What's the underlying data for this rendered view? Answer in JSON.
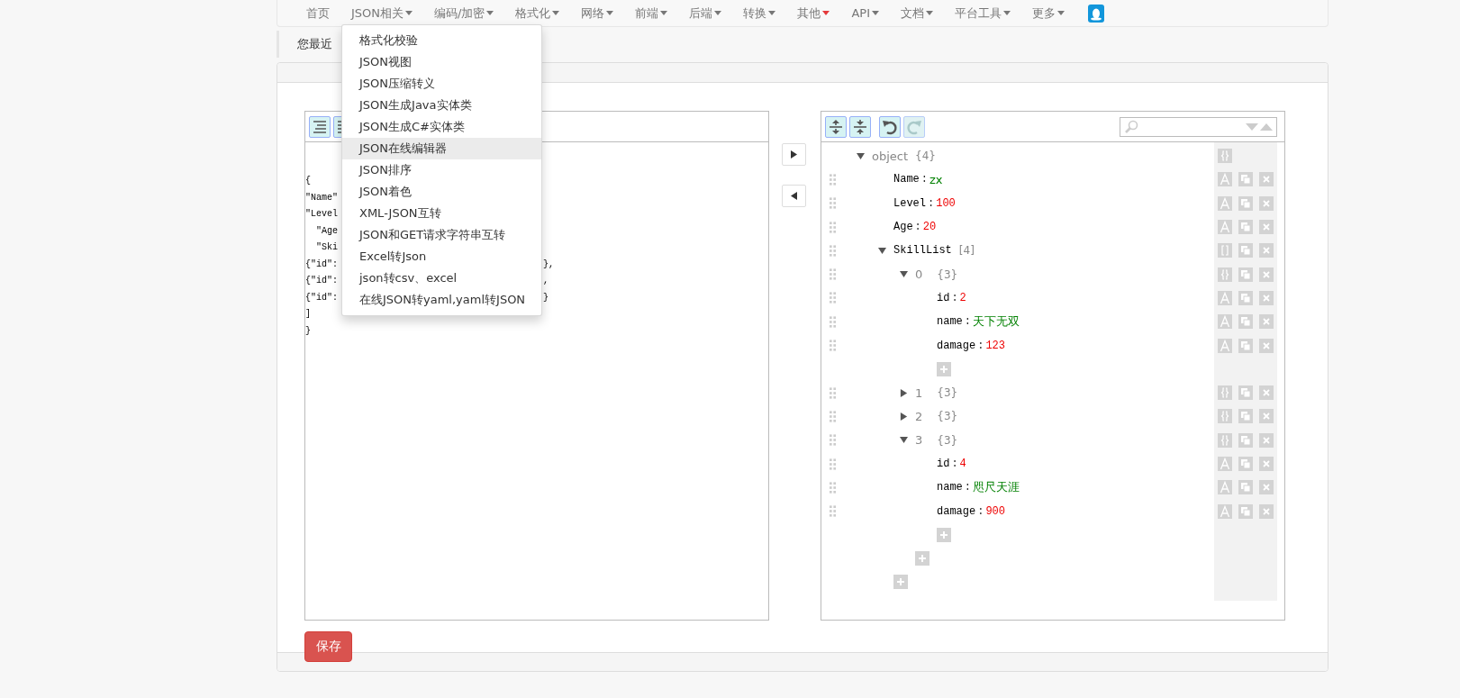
{
  "nav": {
    "items": [
      {
        "label": "首页",
        "dropdown": false
      },
      {
        "label": "JSON相关",
        "dropdown": true,
        "hot": false
      },
      {
        "label": "编码/加密",
        "dropdown": true,
        "hot": false
      },
      {
        "label": "格式化",
        "dropdown": true,
        "hot": false
      },
      {
        "label": "网络",
        "dropdown": true,
        "hot": false
      },
      {
        "label": "前端",
        "dropdown": true,
        "hot": false
      },
      {
        "label": "后端",
        "dropdown": true,
        "hot": false
      },
      {
        "label": "转换",
        "dropdown": true,
        "hot": false
      },
      {
        "label": "其他",
        "dropdown": true,
        "hot": true
      },
      {
        "label": "API",
        "dropdown": true,
        "hot": false
      },
      {
        "label": "文档",
        "dropdown": true,
        "hot": false
      },
      {
        "label": "平台工具",
        "dropdown": true,
        "hot": false
      },
      {
        "label": "更多",
        "dropdown": true,
        "hot": false
      }
    ]
  },
  "recent": {
    "text": "您最近"
  },
  "dropdown": {
    "items": [
      {
        "label": "格式化校验",
        "selected": false
      },
      {
        "label": "JSON视图",
        "selected": false
      },
      {
        "label": "JSON压缩转义",
        "selected": false
      },
      {
        "label": "JSON生成Java实体类",
        "selected": false
      },
      {
        "label": "JSON生成C#实体类",
        "selected": false
      },
      {
        "label": "JSON在线编辑器",
        "selected": true
      },
      {
        "label": "JSON排序",
        "selected": false
      },
      {
        "label": "JSON着色",
        "selected": false
      },
      {
        "label": "XML-JSON互转",
        "selected": false
      },
      {
        "label": "JSON和GET请求字符串互转",
        "selected": false
      },
      {
        "label": "Excel转Json",
        "selected": false
      },
      {
        "label": "json转csv、excel",
        "selected": false
      },
      {
        "label": "在线JSON转yaml,yaml转JSON",
        "selected": false
      }
    ]
  },
  "code_editor": {
    "toolbar": [
      {
        "kind": "format"
      },
      {
        "kind": "compact"
      }
    ],
    "lines": [
      {
        "left": "{"
      },
      {
        "left": "\"Name\""
      },
      {
        "left": "\"Level"
      },
      {
        "left": "  \"Age"
      },
      {
        "left": "  \"Ski"
      },
      {
        "left": "{\"id\":",
        "right": "},"
      },
      {
        "left": "{\"id\":",
        "right": ","
      },
      {
        "left": "{\"id\":",
        "right": "}"
      },
      {
        "left": "]"
      },
      {
        "left": "}"
      }
    ]
  },
  "tree_editor": {
    "toolbar": [
      {
        "kind": "expand-all",
        "disabled": false
      },
      {
        "kind": "collapse-all",
        "disabled": false
      },
      {
        "kind": "undo",
        "disabled": false
      },
      {
        "kind": "redo",
        "disabled": true
      }
    ],
    "tree": {
      "key": "object",
      "count": "{4}",
      "kind": "object",
      "expanded": true,
      "children": [
        {
          "key": "Name",
          "sep": ":",
          "value": "zx",
          "kind": "string"
        },
        {
          "key": "Level",
          "sep": ":",
          "value": "100",
          "kind": "number"
        },
        {
          "key": "Age",
          "sep": ":",
          "value": "20",
          "kind": "number"
        },
        {
          "key": "SkillList",
          "count": "[4]",
          "kind": "array",
          "expanded": true,
          "children": [
            {
              "key": "0",
              "count": "{3}",
              "kind": "object",
              "expanded": true,
              "children": [
                {
                  "key": "id",
                  "sep": ":",
                  "value": "2",
                  "kind": "number"
                },
                {
                  "key": "name",
                  "sep": ":",
                  "value": "天下无双",
                  "kind": "string"
                },
                {
                  "key": "damage",
                  "sep": ":",
                  "value": "123",
                  "kind": "number"
                }
              ]
            },
            {
              "key": "1",
              "count": "{3}",
              "kind": "object",
              "expanded": false
            },
            {
              "key": "2",
              "count": "{3}",
              "kind": "object",
              "expanded": false
            },
            {
              "key": "3",
              "count": "{3}",
              "kind": "object",
              "expanded": true,
              "children": [
                {
                  "key": "id",
                  "sep": ":",
                  "value": "4",
                  "kind": "number"
                },
                {
                  "key": "name",
                  "sep": ":",
                  "value": "咫尺天涯",
                  "kind": "string"
                },
                {
                  "key": "damage",
                  "sep": ":",
                  "value": "900",
                  "kind": "number"
                }
              ]
            }
          ]
        }
      ]
    }
  },
  "save_button": {
    "label": "保存"
  }
}
